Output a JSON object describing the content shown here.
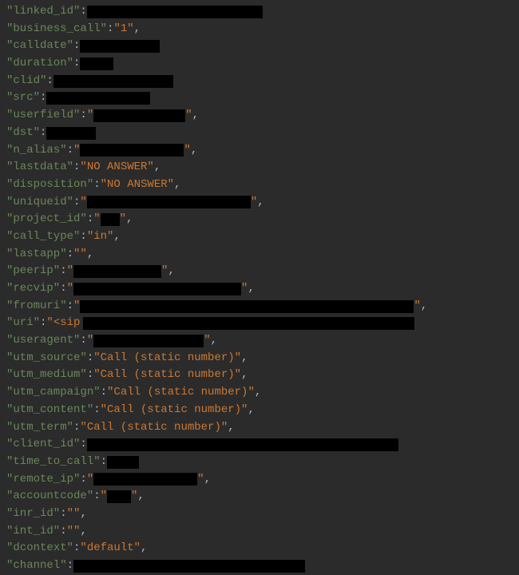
{
  "lines": [
    {
      "key": "linked_id",
      "value": null,
      "redacted_width": 220
    },
    {
      "key": "business_call",
      "value": "1",
      "redacted_width": 0
    },
    {
      "key": "calldate",
      "value": null,
      "redacted_width": 100
    },
    {
      "key": "duration",
      "value": null,
      "redacted_width": 42
    },
    {
      "key": "clid",
      "value": null,
      "redacted_width": 150
    },
    {
      "key": "src",
      "value": null,
      "redacted_width": 130
    },
    {
      "key": "userfield",
      "value": null,
      "redacted_width": 115,
      "quoted": true
    },
    {
      "key": "dst",
      "value": null,
      "redacted_width": 62
    },
    {
      "key": "n_alias",
      "value": null,
      "redacted_width": 130,
      "quoted": true
    },
    {
      "key": "lastdata",
      "value": "NO ANSWER",
      "redacted_width": 0
    },
    {
      "key": "disposition",
      "value": "NO ANSWER",
      "redacted_width": 0
    },
    {
      "key": "uniqueid",
      "value": null,
      "redacted_width": 205,
      "quoted": true
    },
    {
      "key": "project_id",
      "value": null,
      "redacted_width": 24,
      "quoted": true
    },
    {
      "key": "call_type",
      "value": "in",
      "redacted_width": 0
    },
    {
      "key": "lastapp",
      "value": "",
      "redacted_width": 0
    },
    {
      "key": "peerip",
      "value": null,
      "redacted_width": 110,
      "quoted": true
    },
    {
      "key": "recvip",
      "value": null,
      "redacted_width": 210,
      "quoted": true
    },
    {
      "key": "fromuri",
      "value": null,
      "redacted_width": 418,
      "quoted": true,
      "prefix": ""
    },
    {
      "key": "uri",
      "value": "<sip",
      "redacted_width": 415,
      "unclosed": true
    },
    {
      "key": "useragent",
      "value": null,
      "redacted_width": 138,
      "quoted": true
    },
    {
      "key": "utm_source",
      "value": "Call (static number)",
      "redacted_width": 0
    },
    {
      "key": "utm_medium",
      "value": "Call (static number)",
      "redacted_width": 0
    },
    {
      "key": "utm_campaign",
      "value": "Call (static number)",
      "redacted_width": 0
    },
    {
      "key": "utm_content",
      "value": "Call (static number)",
      "redacted_width": 0
    },
    {
      "key": "utm_term",
      "value": "Call (static number)",
      "redacted_width": 0
    },
    {
      "key": "client_id",
      "value": null,
      "redacted_width": 390
    },
    {
      "key": "time_to_call",
      "value": null,
      "redacted_width": 40
    },
    {
      "key": "remote_ip",
      "value": null,
      "redacted_width": 130,
      "quoted": true
    },
    {
      "key": "accountcode",
      "value": null,
      "redacted_width": 30,
      "quoted": true
    },
    {
      "key": "inr_id",
      "value": "",
      "redacted_width": 0
    },
    {
      "key": "int_id",
      "value": "",
      "redacted_width": 0
    },
    {
      "key": "dcontext",
      "value": "default",
      "redacted_width": 0
    },
    {
      "key": "channel",
      "value": null,
      "redacted_width": 290
    }
  ]
}
